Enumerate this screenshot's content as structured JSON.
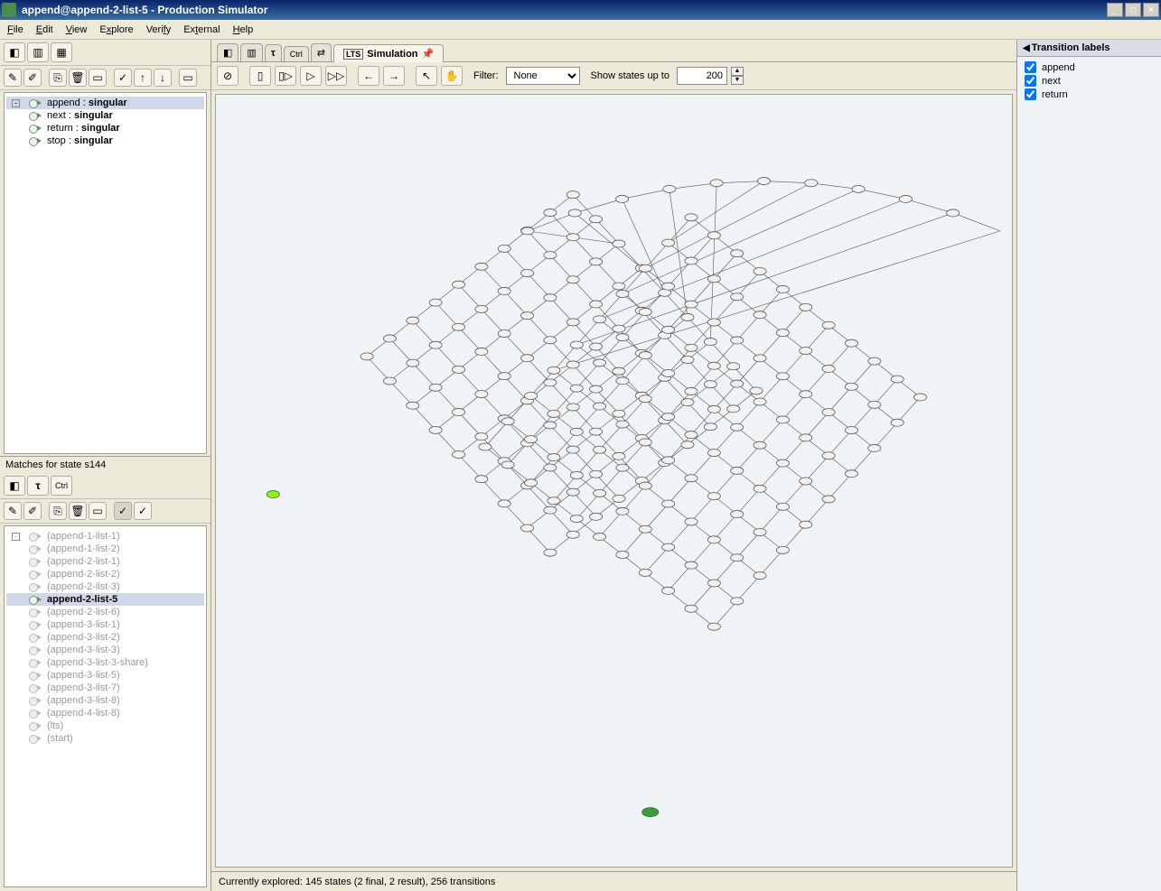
{
  "window": {
    "title": "append@append-2-list-5 - Production Simulator",
    "minimize": "_",
    "maximize": "□",
    "close": "×"
  },
  "menu": {
    "file": "File",
    "edit": "Edit",
    "view": "View",
    "explore": "Explore",
    "verify": "Verify",
    "external": "External",
    "help": "Help"
  },
  "rules": {
    "items": [
      {
        "name": "append",
        "kind": "singular",
        "selected": true
      },
      {
        "name": "next",
        "kind": "singular",
        "selected": false
      },
      {
        "name": "return",
        "kind": "singular",
        "selected": false
      },
      {
        "name": "stop",
        "kind": "singular",
        "selected": false
      }
    ]
  },
  "matches": {
    "header": "Matches for state s144",
    "items": [
      {
        "label": "(append-1-list-1)",
        "grey": true
      },
      {
        "label": "(append-1-list-2)",
        "grey": true
      },
      {
        "label": "(append-2-list-1)",
        "grey": true
      },
      {
        "label": "(append-2-list-2)",
        "grey": true
      },
      {
        "label": "(append-2-list-3)",
        "grey": true
      },
      {
        "label": "append-2-list-5",
        "grey": false,
        "selected": true
      },
      {
        "label": "(append-2-list-6)",
        "grey": true
      },
      {
        "label": "(append-3-list-1)",
        "grey": true
      },
      {
        "label": "(append-3-list-2)",
        "grey": true
      },
      {
        "label": "(append-3-list-3)",
        "grey": true
      },
      {
        "label": "(append-3-list-3-share)",
        "grey": true
      },
      {
        "label": "(append-3-list-5)",
        "grey": true
      },
      {
        "label": "(append-3-list-7)",
        "grey": true
      },
      {
        "label": "(append-3-list-8)",
        "grey": true
      },
      {
        "label": "(append-4-list-8)",
        "grey": true
      },
      {
        "label": "(lts)",
        "grey": true
      },
      {
        "label": "(start)",
        "grey": true
      }
    ]
  },
  "tabs": {
    "lts": "LTS",
    "simulation": "Simulation"
  },
  "maintoolbar": {
    "filter_label": "Filter:",
    "filter_value": "None",
    "show_label": "Show states up to",
    "show_value": "200"
  },
  "rightpanel": {
    "header": "Transition labels",
    "labels": [
      {
        "name": "append",
        "checked": true
      },
      {
        "name": "next",
        "checked": true
      },
      {
        "name": "return",
        "checked": true
      }
    ]
  },
  "status": "Currently explored: 145 states (2 final, 2 result), 256 transitions",
  "sep": " : "
}
